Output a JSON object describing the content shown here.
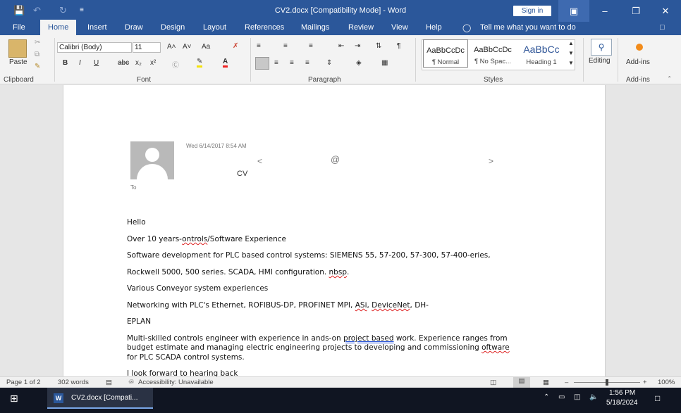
{
  "app": {
    "window_title": "CV2.docx [Compatibility Mode]  -  Word",
    "sign_in": "Sign in",
    "save_icon": "save-icon",
    "undo_icon": "undo-icon",
    "redo_icon": "redo-icon"
  },
  "ribbon": {
    "tabs": [
      "File",
      "Home",
      "Insert",
      "Draw",
      "Design",
      "Layout",
      "References",
      "Mailings",
      "Review",
      "View",
      "Help"
    ],
    "active_tab": "Home",
    "tell_me": "Tell me what you want to do",
    "font_name": "Calibri (Body)",
    "font_size": "11",
    "paste_label": "Paste",
    "groups": {
      "clipboard": "Clipboard",
      "font": "Font",
      "paragraph": "Paragraph",
      "styles": "Styles",
      "editing": "Editing",
      "addins": "Add-ins"
    },
    "styles": [
      {
        "preview": "AaBbCcDc",
        "name": "¶ Normal"
      },
      {
        "preview": "AaBbCcDc",
        "name": "¶ No Spac..."
      },
      {
        "preview": "AaBbCc",
        "name": "Heading 1"
      }
    ],
    "editing_label": "Editing",
    "addins_label": "Add-ins",
    "font_buttons": {
      "bold": "B",
      "italic": "I",
      "underline": "U",
      "strike": "abc",
      "subscript": "x₂",
      "superscript": "x²",
      "grow": "A˄",
      "shrink": "A˅",
      "case": "Aa",
      "font_color": "A"
    },
    "pilcrow": "¶"
  },
  "document": {
    "header_date": "Wed 6/14/2017 8:54 AM",
    "lt": "<",
    "at": "@",
    "gt": ">",
    "cv": "CV",
    "to": "To",
    "lines": {
      "hello": "Hello",
      "l1_a": "Over 10 years-",
      "l1_b": "ontrols",
      "l1_c": "/Software Experience",
      "l2": "Software development for PLC based control systems: SIEMENS 55, 57-200, 57-300, 57-400-eries,",
      "l3_a": "Rockwell 5000, 500 series. SCADA, HMI configuration. ",
      "l3_b": "nbsp",
      "l3_c": ".",
      "l4": "Various Conveyor system experiences",
      "l5_a": "Networking with PLC's Ethernet, ROFIBUS-DP, PROFINET MPI, ",
      "l5_b": "ASi",
      "l5_c": ", ",
      "l5_d": "DeviceNet",
      "l5_e": ", DH-",
      "l6": "EPLAN",
      "l7_a": "Multi-skilled controls engineer with experience in ands-on ",
      "l7_b": "project based",
      "l7_c": " work. Experience ranges from",
      "l8_a": "budget estimate and managing electric engineering projects to developing and commissioning ",
      "l8_b": "oftware",
      "l9": "for PLC SCADA control systems.",
      "l10": "I look forward to hearing back"
    }
  },
  "status": {
    "page": "Page 1 of 2",
    "words": "302 words",
    "accessibility": "Accessibility: Unavailable",
    "zoom": "100%"
  },
  "taskbar": {
    "app_label": "CV2.docx [Compati...",
    "time": "1:56 PM",
    "date": "5/18/2024"
  }
}
